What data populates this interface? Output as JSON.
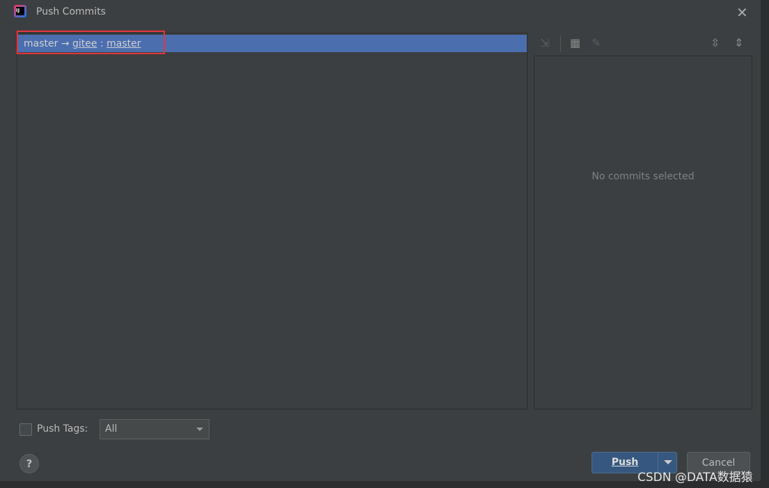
{
  "window": {
    "title": "Push Commits"
  },
  "branch_row": {
    "local": "master",
    "arrow": "→",
    "remote": "gitee",
    "sep": ":",
    "remote_branch": "master"
  },
  "details": {
    "empty_text": "No commits selected"
  },
  "push_tags": {
    "label": "Push Tags:",
    "checked": false,
    "selected": "All"
  },
  "buttons": {
    "push": "Push",
    "cancel": "Cancel",
    "help": "?"
  },
  "watermark": "CSDN @DATA数据猿"
}
